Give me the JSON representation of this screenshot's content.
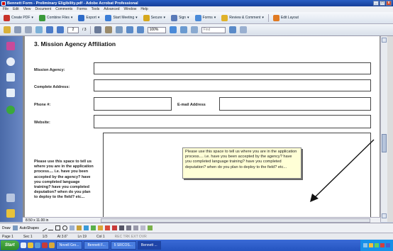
{
  "window": {
    "title": "Bennett Form - Preliminary Eligibility.pdf - Adobe Acrobat Professional",
    "controls": [
      "_",
      "□",
      "x"
    ]
  },
  "menu": [
    "File",
    "Edit",
    "View",
    "Document",
    "Comments",
    "Forms",
    "Tools",
    "Advanced",
    "Window",
    "Help"
  ],
  "toolbar": {
    "create_pdf": "Create PDF",
    "combine_files": "Combine Files",
    "export": "Export",
    "start_meeting": "Start Meeting",
    "secure": "Secure",
    "sign": "Sign",
    "forms": "Forms",
    "review_comment": "Review & Comment",
    "edit_layout": "Edit Layout"
  },
  "nav_toolbar": {
    "page_current": "2",
    "page_total": "/ 3",
    "zoom": "100%",
    "find_placeholder": "Find"
  },
  "form": {
    "section_title": "3. Mission Agency Affiliation",
    "mission_agency_label": "Mission Agency:",
    "address_label": "Complete Address:",
    "phone_label": "Phone #:",
    "email_label": "E-mail Address",
    "website_label": "Website:",
    "process_label": "Please use this space to tell us where you are in the application process.... i.e. have you been accepted by the agency? have you completed language training? have you completed deputation? when do you plan to deploy to the field? etc...",
    "tooltip": "Please use this space to tell us where you are in the application process.... i.e. have you been accepted by the agency? have you completed language training? have you completed deputation? when do you plan to deploy to the field? etc..."
  },
  "page_size": "8.50 x 11.00 in",
  "drawing_toolbar": {
    "draw": "Draw",
    "autoshapes": "AutoShapes"
  },
  "status": {
    "page": "Page 1",
    "sec": "Sec 1",
    "pages": "1/3",
    "at": "At 3.6\"",
    "ln": "Ln 19",
    "col": "Col 1",
    "modes": "REC  TRK  EXT  OVR"
  },
  "taskbar": {
    "start": "Start",
    "tasks": [
      "Novell Gro...",
      "Bennett F...",
      "5 SRCOS...",
      "Bennett ..."
    ],
    "active_index": 3
  },
  "colors": {
    "arrow": "#111111",
    "tooltip_bg": "#ffffd6"
  }
}
